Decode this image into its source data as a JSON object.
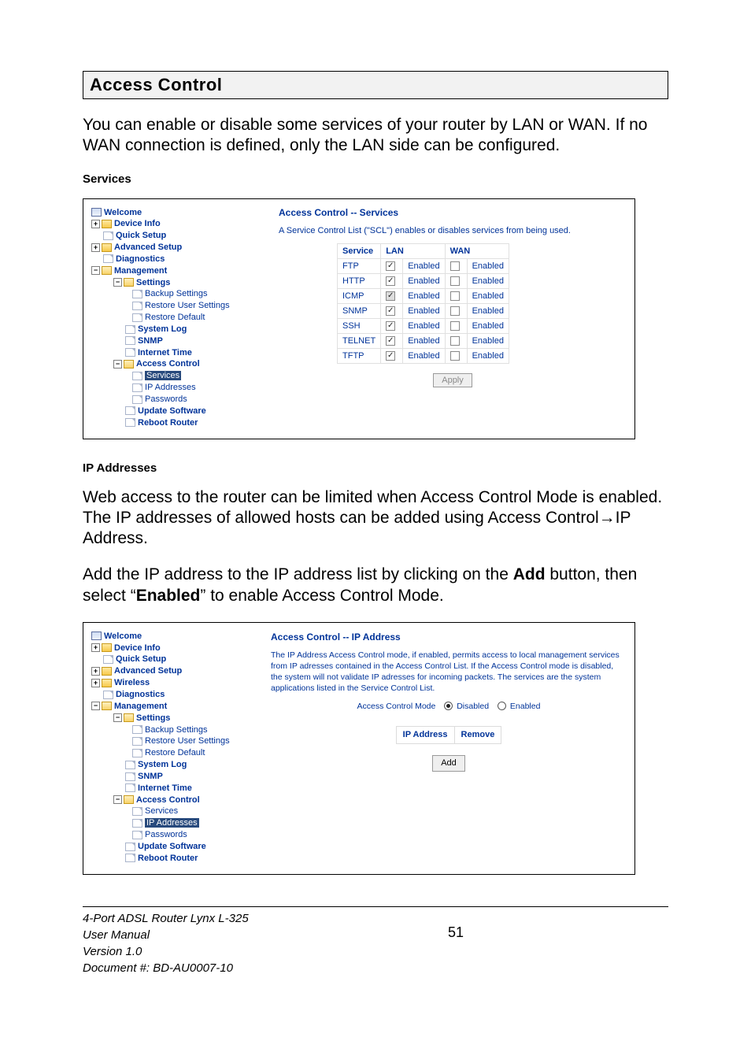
{
  "section_title": "Access Control",
  "intro": "You can enable or disable some services of your router by LAN or WAN. If no WAN connection is defined, only the LAN side can be configured.",
  "services_heading": "Services",
  "screenshot1": {
    "title": "Access Control -- Services",
    "desc": "A Service Control List (\"SCL\") enables or disables services from being used.",
    "columns": {
      "service": "Service",
      "lan": "LAN",
      "wan": "WAN"
    },
    "enabled_label": "Enabled",
    "rows": [
      {
        "name": "FTP",
        "lan": true,
        "lan_disabled": false,
        "wan": false
      },
      {
        "name": "HTTP",
        "lan": true,
        "lan_disabled": false,
        "wan": false
      },
      {
        "name": "ICMP",
        "lan": true,
        "lan_disabled": true,
        "wan": false
      },
      {
        "name": "SNMP",
        "lan": true,
        "lan_disabled": false,
        "wan": false
      },
      {
        "name": "SSH",
        "lan": true,
        "lan_disabled": false,
        "wan": false
      },
      {
        "name": "TELNET",
        "lan": true,
        "lan_disabled": false,
        "wan": false
      },
      {
        "name": "TFTP",
        "lan": true,
        "lan_disabled": false,
        "wan": false
      }
    ],
    "apply": "Apply"
  },
  "tree1": {
    "welcome": "Welcome",
    "device_info": "Device Info",
    "quick_setup": "Quick Setup",
    "advanced_setup": "Advanced Setup",
    "diagnostics": "Diagnostics",
    "management": "Management",
    "settings": "Settings",
    "backup_settings": "Backup Settings",
    "restore_user_settings": "Restore User Settings",
    "restore_default": "Restore Default",
    "system_log": "System Log",
    "snmp": "SNMP",
    "internet_time": "Internet Time",
    "access_control": "Access Control",
    "services": "Services",
    "ip_addresses": "IP Addresses",
    "passwords": "Passwords",
    "update_software": "Update Software",
    "reboot_router": "Reboot Router"
  },
  "ip_heading": "IP Addresses",
  "ip_para1": "Web access to the router can be limited when Access Control Mode is enabled. The IP addresses of allowed hosts can be added using Access Control→IP Address.",
  "ip_para2_a": "Add the IP address to the IP address list by clicking on the ",
  "ip_para2_add": "Add",
  "ip_para2_b": " button, then select “",
  "ip_para2_enabled": "Enabled",
  "ip_para2_c": "” to enable Access Control Mode.",
  "tree2": {
    "welcome": "Welcome",
    "device_info": "Device Info",
    "quick_setup": "Quick Setup",
    "advanced_setup": "Advanced Setup",
    "wireless": "Wireless",
    "diagnostics": "Diagnostics",
    "management": "Management",
    "settings": "Settings",
    "backup_settings": "Backup Settings",
    "restore_user_settings": "Restore User Settings",
    "restore_default": "Restore Default",
    "system_log": "System Log",
    "snmp": "SNMP",
    "internet_time": "Internet Time",
    "access_control": "Access Control",
    "services": "Services",
    "ip_addresses": "IP Addresses",
    "passwords": "Passwords",
    "update_software": "Update Software",
    "reboot_router": "Reboot Router"
  },
  "screenshot2": {
    "title": "Access Control -- IP Address",
    "desc": "The IP Address Access Control mode, if enabled, permits access to local management services from IP adresses contained in the Access Control List. If the Access Control mode is disabled, the system will not validate IP adresses for incoming packets. The services are the system applications listed in the Service Control List.",
    "acm_label": "Access Control Mode",
    "disabled": "Disabled",
    "enabled": "Enabled",
    "cols": {
      "ip": "IP Address",
      "remove": "Remove"
    },
    "add": "Add"
  },
  "footer": {
    "l1": "4-Port ADSL Router Lynx L-325",
    "l2": "User Manual",
    "l3": "Version 1.0",
    "l4": "Document #:  BD-AU0007-10",
    "page": "51"
  }
}
